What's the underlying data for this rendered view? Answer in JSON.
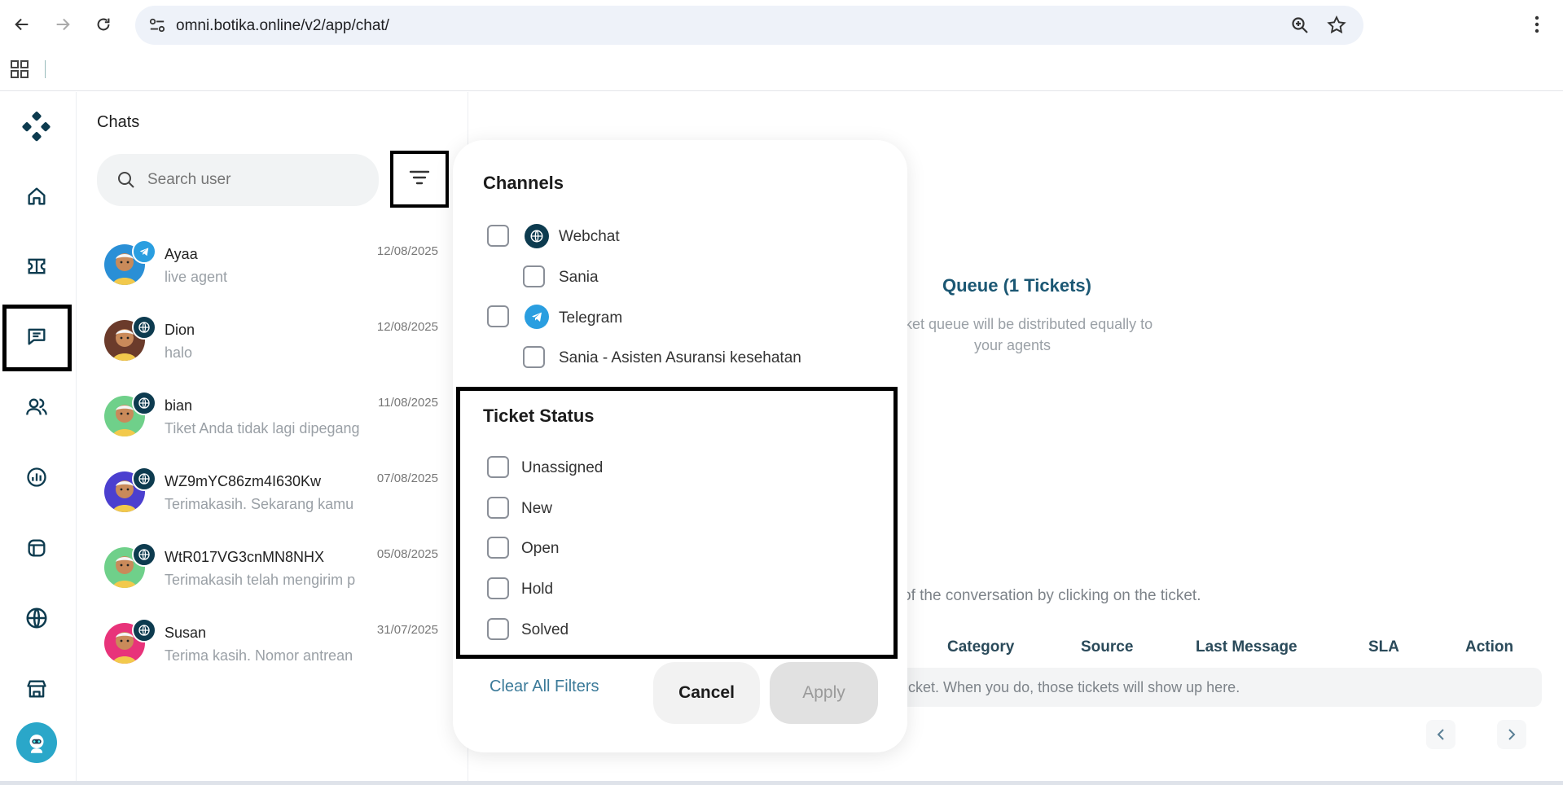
{
  "browser": {
    "url": "omni.botika.online/v2/app/chat/"
  },
  "sidebar": {
    "items": [
      "logo",
      "home",
      "tickets",
      "chats",
      "contacts",
      "analytics",
      "templates",
      "channels",
      "store",
      "bot"
    ]
  },
  "chats_panel": {
    "title": "Chats",
    "search_placeholder": "Search user",
    "items": [
      {
        "name": "Ayaa",
        "message": "live agent",
        "date": "12/08/2025",
        "channel": "telegram-icon",
        "avatar_bg": "#2a8fd6"
      },
      {
        "name": "Dion",
        "message": "halo",
        "date": "12/08/2025",
        "channel": "webchat-icon",
        "avatar_bg": "#6b3b2b"
      },
      {
        "name": "bian",
        "message": "Tiket Anda tidak lagi dipegang",
        "date": "11/08/2025",
        "channel": "webchat-icon",
        "avatar_bg": "#6fd08a"
      },
      {
        "name": "WZ9mYC86zm4I630Kw",
        "message": "Terimakasih. Sekarang kamu",
        "date": "07/08/2025",
        "channel": "webchat-icon",
        "avatar_bg": "#4b3fcf"
      },
      {
        "name": "WtR017VG3cnMN8NHX",
        "message": "Terimakasih telah mengirim p",
        "date": "05/08/2025",
        "channel": "webchat-icon",
        "avatar_bg": "#6fd08a"
      },
      {
        "name": "Susan",
        "message": "Terima kasih. Nomor antrean",
        "date": "31/07/2025",
        "channel": "webchat-icon",
        "avatar_bg": "#e8337a"
      }
    ]
  },
  "queue": {
    "title": "Queue (1 Tickets)",
    "desc_line1": "ket queue will be distributed equally to",
    "desc_line2": "your agents",
    "hint": "of the conversation by clicking on the ticket.",
    "columns": [
      "Category",
      "Source",
      "Last Message",
      "SLA",
      "Action"
    ],
    "empty": "icket. When you do, those tickets will show up here."
  },
  "filter_modal": {
    "channels_title": "Channels",
    "channels": [
      {
        "label": "Webchat",
        "icon": "webchat-icon"
      },
      {
        "label": "Sania"
      },
      {
        "label": "Telegram",
        "icon": "telegram-icon"
      },
      {
        "label": "Sania - Asisten Asuransi kesehatan"
      }
    ],
    "status_title": "Ticket Status",
    "statuses": [
      "Unassigned",
      "New",
      "Open",
      "Hold",
      "Solved"
    ],
    "clear_label": "Clear All Filters",
    "cancel_label": "Cancel",
    "apply_label": "Apply"
  },
  "colors": {
    "brand_dark": "#0d3b4f",
    "telegram": "#2a9ee0",
    "link": "#3b7a99"
  }
}
